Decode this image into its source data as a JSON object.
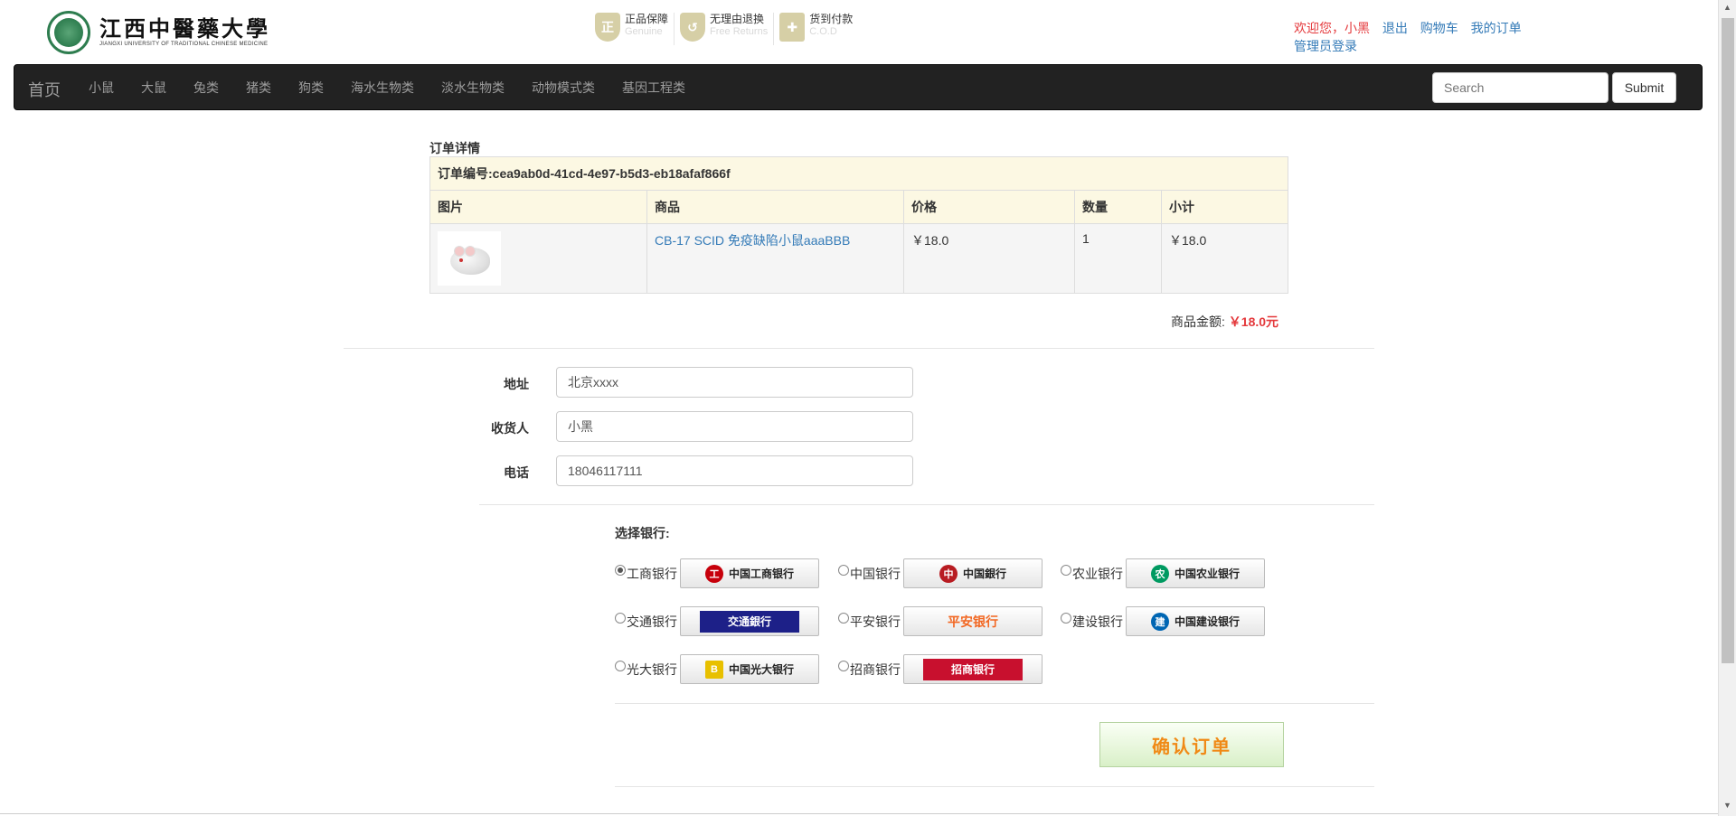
{
  "header": {
    "logo_cn": "江西中醫藥大學",
    "logo_en": "JIANGXI UNIVERSITY OF TRADITIONAL CHINESE MEDICINE",
    "guarantees": [
      {
        "icon": "shield-icon",
        "cn": "正品保障",
        "en": "Genuine"
      },
      {
        "icon": "return-icon",
        "cn": "无理由退换",
        "en": "Free Returns"
      },
      {
        "icon": "box-icon",
        "cn": "货到付款",
        "en": "C.O.D"
      }
    ],
    "welcome": "欢迎您，小黑",
    "links": [
      "退出",
      "购物车",
      "我的订单"
    ],
    "admin_login": "管理员登录"
  },
  "navbar": {
    "brand": "首页",
    "items": [
      "小鼠",
      "大鼠",
      "兔类",
      "猪类",
      "狗类",
      "海水生物类",
      "淡水生物类",
      "动物模式类",
      "基因工程类"
    ],
    "search_placeholder": "Search",
    "submit_label": "Submit"
  },
  "order": {
    "title": "订单详情",
    "number_label": "订单编号:cea9ab0d-41cd-4e97-b5d3-eb18afaf866f",
    "columns": [
      "图片",
      "商品",
      "价格",
      "数量",
      "小计"
    ],
    "items": [
      {
        "product": "CB-17 SCID 免疫缺陷小鼠aaaBBB",
        "price": "￥18.0",
        "qty": "1",
        "subtotal": "￥18.0"
      }
    ],
    "total_label": "商品金额:",
    "total_value": "￥18.0元"
  },
  "form": {
    "address_label": "地址",
    "address_value": "北京xxxx",
    "receiver_label": "收货人",
    "receiver_value": "小黑",
    "phone_label": "电话",
    "phone_value": "18046117111"
  },
  "banks": {
    "title": "选择银行:",
    "selected": "工商银行",
    "list": [
      {
        "name": "工商银行",
        "logo_text": "中国工商银行",
        "color": "#c7000b"
      },
      {
        "name": "中国银行",
        "logo_text": "中国銀行",
        "color": "#b81c22"
      },
      {
        "name": "农业银行",
        "logo_text": "中国农业银行",
        "color": "#009a61"
      },
      {
        "name": "交通银行",
        "logo_text": "交通銀行",
        "color": "#1d2088"
      },
      {
        "name": "平安银行",
        "logo_text": "平安银行",
        "color": "#f26722"
      },
      {
        "name": "建设银行",
        "logo_text": "中国建设银行",
        "color": "#0066b3"
      },
      {
        "name": "光大银行",
        "logo_text": "中国光大银行",
        "color": "#6a1b7a"
      },
      {
        "name": "招商银行",
        "logo_text": "招商银行",
        "color": "#c8102e"
      }
    ]
  },
  "confirm_label": "确认订单"
}
